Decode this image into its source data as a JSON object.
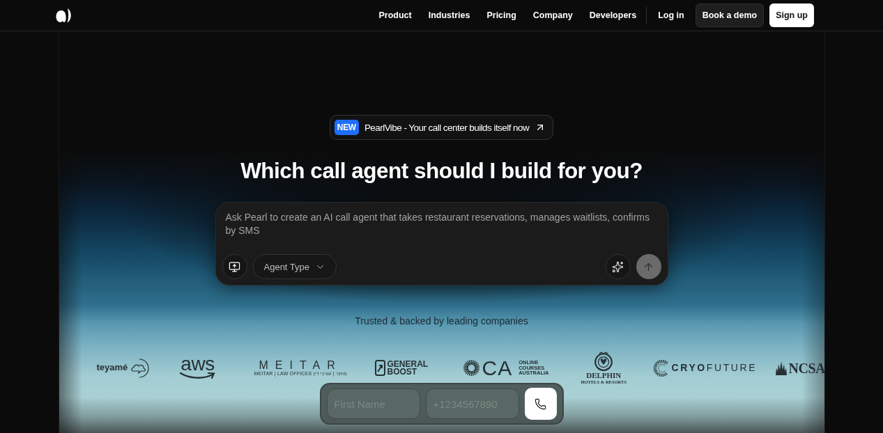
{
  "nav": {
    "links": [
      {
        "label": "Product"
      },
      {
        "label": "Industries"
      },
      {
        "label": "Pricing"
      },
      {
        "label": "Company"
      },
      {
        "label": "Developers"
      }
    ],
    "login": "Log in",
    "demo": "Book a demo",
    "signup": "Sign up"
  },
  "announcement": {
    "tag": "NEW",
    "text": "PearlVibe - Your call center builds itself now"
  },
  "heading": "Which call agent should I build for you?",
  "prompt": {
    "placeholder": "Ask Pearl to create an AI call agent that takes restaurant reservations, manages waitlists, confirms by SMS",
    "agent_type": "Agent Type",
    "send": {
      "disabled": true
    }
  },
  "trusted": "Trusted & backed by leading companies",
  "logos": [
    {
      "kind": "teyame",
      "name": "teyamé"
    },
    {
      "kind": "aws",
      "name": "aws"
    },
    {
      "kind": "meitar",
      "name": "MEITAR",
      "tagline": "MEITAR | LAW OFFICES   מיתר | עורכי דין"
    },
    {
      "kind": "general-boost",
      "name": "GENERAL BOOST"
    },
    {
      "kind": "oca",
      "name": "CA",
      "tagline": "ONLINE COURSES AUSTRALIA"
    },
    {
      "kind": "delphin",
      "name": "DELPHIN",
      "tagline": "HOTELS & RESORTS"
    },
    {
      "kind": "cryo",
      "name": "**CRYO**FUTURE"
    },
    {
      "kind": "ncsa",
      "name": "NCSA"
    }
  ],
  "call_form": {
    "first_name": {
      "placeholder": "First Name"
    },
    "phone": {
      "placeholder": "+1234567890"
    }
  }
}
